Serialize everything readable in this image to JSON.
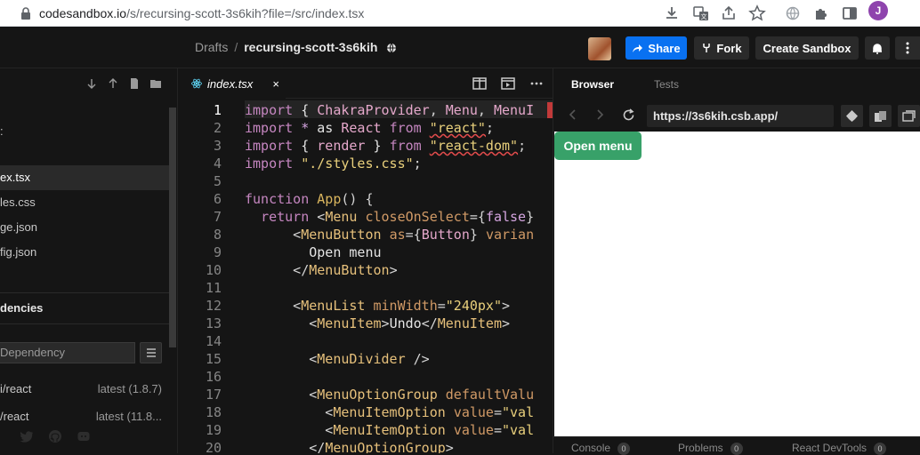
{
  "browser": {
    "url_host": "codesandbox.io",
    "url_path": "/s/recursing-scott-3s6kih?file=/src/index.tsx",
    "profile_initial": "J"
  },
  "header": {
    "breadcrumb_parent": "Drafts",
    "breadcrumb_separator": "/",
    "sandbox_name": "recursing-scott-3s6kih",
    "share_label": "Share",
    "fork_label": "Fork",
    "create_label": "Create Sandbox"
  },
  "sidebar": {
    "files": [
      {
        "label": "ex.tsx",
        "active": true
      },
      {
        "label": "les.css"
      },
      {
        "label": "ge.json"
      },
      {
        "label": "fig.json"
      }
    ],
    "colon": ":",
    "dependencies_title": "dencies",
    "add_dependency_placeholder": "Dependency",
    "dependencies": [
      {
        "name": "i/react",
        "version": "latest (1.8.7)"
      },
      {
        "name": "/react",
        "version": "latest (11.8..."
      }
    ]
  },
  "editor": {
    "tab_label": "index.tsx",
    "tab_close": "×",
    "current_line": 1,
    "lines": [
      {
        "n": "1"
      },
      {
        "n": "2"
      },
      {
        "n": "3"
      },
      {
        "n": "4"
      },
      {
        "n": "5"
      },
      {
        "n": "6"
      },
      {
        "n": "7"
      },
      {
        "n": "8"
      },
      {
        "n": "9"
      },
      {
        "n": "10"
      },
      {
        "n": "11"
      },
      {
        "n": "12"
      },
      {
        "n": "13"
      },
      {
        "n": "14"
      },
      {
        "n": "15"
      },
      {
        "n": "16"
      },
      {
        "n": "17"
      },
      {
        "n": "18"
      },
      {
        "n": "19"
      },
      {
        "n": "20"
      }
    ]
  },
  "preview": {
    "tab_browser": "Browser",
    "tab_tests": "Tests",
    "url": "https://3s6kih.csb.app/",
    "open_menu_label": "Open menu",
    "console_label": "Console",
    "console_count": "0",
    "problems_label": "Problems",
    "problems_count": "0",
    "devtools_label": "React DevTools",
    "devtools_count": "0"
  },
  "colors": {
    "accent": "#0971f1",
    "chakra_green": "#38a169",
    "profile": "#8e44ad"
  },
  "icons": [
    "lock-icon",
    "download-icon",
    "translate-icon",
    "share-page-icon",
    "star-icon",
    "extension-puzzle-icon",
    "sidepanel-icon",
    "globe-icon",
    "bell-icon",
    "more-vertical-icon",
    "fork-icon",
    "arrow-down-icon",
    "arrow-up-icon",
    "new-file-icon",
    "new-folder-icon",
    "react-atom-icon",
    "split-view-icon",
    "preview-toggle-icon",
    "ellipsis-icon",
    "back-icon",
    "forward-icon",
    "refresh-icon",
    "codesandbox-icon",
    "devices-icon",
    "new-window-icon",
    "twitter-icon",
    "github-icon",
    "discord-icon",
    "menu-lines-icon"
  ]
}
